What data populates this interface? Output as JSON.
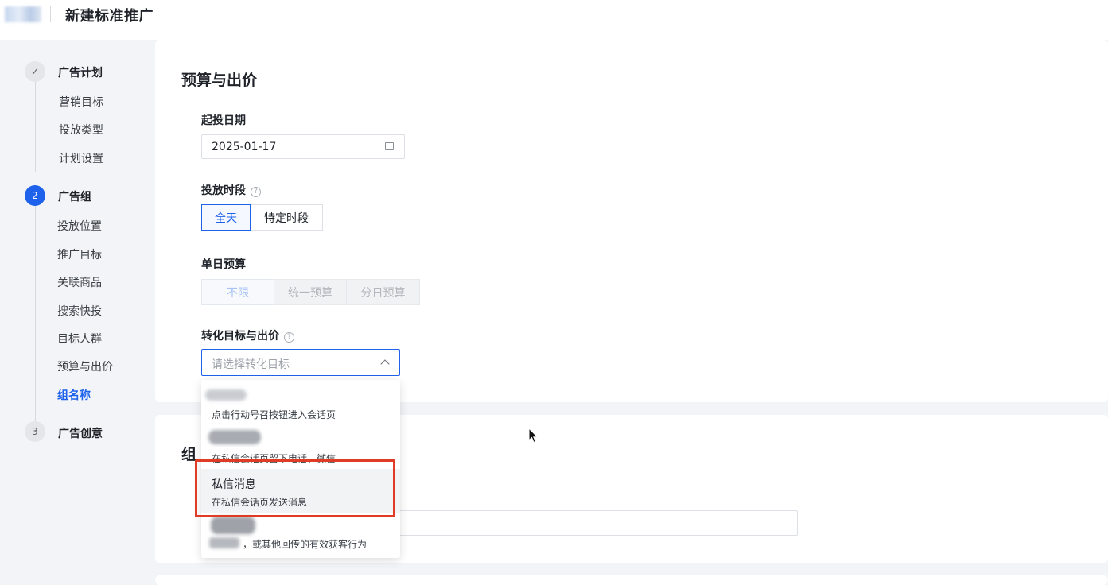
{
  "header": {
    "title": "新建标准推广"
  },
  "sidebar": {
    "steps": [
      {
        "number": "✓",
        "title": "广告计划",
        "items": [
          "营销目标",
          "投放类型",
          "计划设置"
        ]
      },
      {
        "number": "2",
        "title": "广告组",
        "items": [
          "投放位置",
          "推广目标",
          "关联商品",
          "搜索快投",
          "目标人群",
          "预算与出价",
          "组名称"
        ]
      },
      {
        "number": "3",
        "title": "广告创意",
        "items": []
      }
    ]
  },
  "budget_section": {
    "title": "预算与出价",
    "start_date": {
      "label": "起投日期",
      "value": "2025-01-17"
    },
    "time_slot": {
      "label": "投放时段",
      "options": [
        "全天",
        "特定时段"
      ],
      "selected": "全天"
    },
    "daily_budget": {
      "label": "单日预算",
      "options": [
        "不限",
        "统一预算",
        "分日预算"
      ],
      "selected": "不限"
    },
    "conversion": {
      "label": "转化目标与出价",
      "placeholder": "请选择转化目标"
    }
  },
  "dropdown": {
    "options": [
      {
        "title": "",
        "desc": "点击行动号召按钮进入会话页"
      },
      {
        "title": "",
        "desc": "在私信会话页留下电话、微信"
      },
      {
        "title": "私信消息",
        "desc": "在私信会话页发送消息"
      },
      {
        "title": "",
        "desc": "，或其他回传的有效获客行为"
      }
    ]
  },
  "group_section": {
    "title_partial": "组"
  }
}
